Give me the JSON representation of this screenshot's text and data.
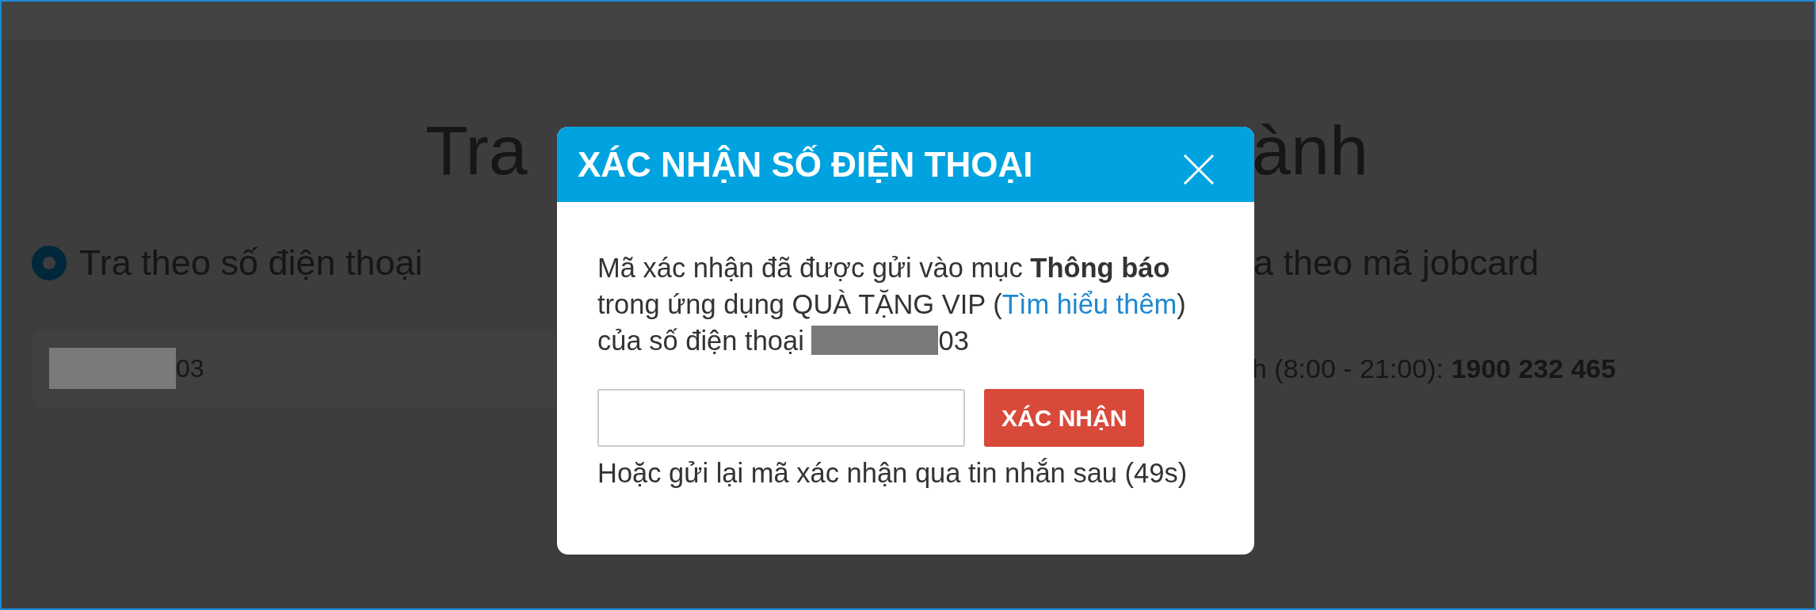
{
  "page": {
    "title_left": "Tra",
    "title_right": "ành",
    "phone_option": {
      "label": "Tra theo số điện thoại",
      "selected": true
    },
    "jobcard_option_label": "a theo mã jobcard",
    "phone_field": {
      "value_suffix": "03"
    },
    "hotline": "h (8:00 - 21:00): **1900 232 465**"
  },
  "dialog": {
    "title": "XÁC NHẬN SỐ ĐIỆN THOẠI",
    "message_before": "Mã xác nhận đã được gửi vào mục **Thông báo** trong ứng dụng QUÀ TẶNG VIP (",
    "link": "Tìm hiểu thêm",
    "message_after": ") của số điện thoại",
    "phone_suffix": "03",
    "confirm_button": "XÁC NHẬN",
    "resend_note": "Hoặc gửi lại mã xác nhận qua tin nhắn sau (49s)"
  }
}
